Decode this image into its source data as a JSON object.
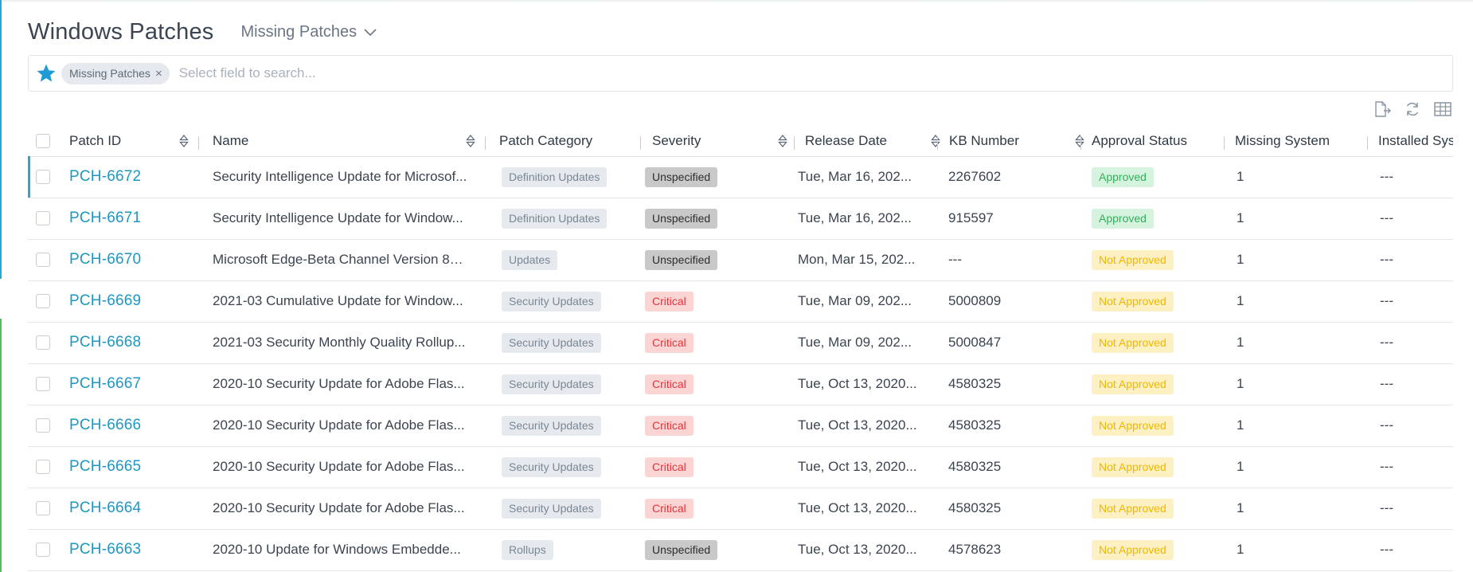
{
  "header": {
    "title": "Windows Patches",
    "view_label": "Missing Patches"
  },
  "search": {
    "chip_label": "Missing Patches",
    "chip_close": "×",
    "placeholder": "Select field to search..."
  },
  "toolbar": {
    "icons": [
      "export-icon",
      "refresh-icon",
      "table-columns-icon"
    ]
  },
  "colors": {
    "accent": "#1d97c4",
    "star": "#1e9ad6",
    "critical_text": "#e0353b",
    "approved_text": "#32b05a",
    "not_approved_text": "#f2b600"
  },
  "table": {
    "columns": [
      "Patch ID",
      "Name",
      "Patch Category",
      "Severity",
      "Release Date",
      "KB Number",
      "Approval Status",
      "Missing System",
      "Installed Sys"
    ],
    "rows": [
      {
        "id": "PCH-6672",
        "name": "Security Intelligence Update for Microsof...",
        "category": "Definition Updates",
        "severity": "Unspecified",
        "release_date": "Tue, Mar 16, 202...",
        "kb": "2267602",
        "approval": "Approved",
        "missing": "1",
        "installed": "---"
      },
      {
        "id": "PCH-6671",
        "name": "Security Intelligence Update for Window...",
        "category": "Definition Updates",
        "severity": "Unspecified",
        "release_date": "Tue, Mar 16, 202...",
        "kb": "915597",
        "approval": "Approved",
        "missing": "1",
        "installed": "---"
      },
      {
        "id": "PCH-6670",
        "name": "Microsoft Edge-Beta Channel Version 89...",
        "category": "Updates",
        "severity": "Unspecified",
        "release_date": "Mon, Mar 15, 202...",
        "kb": "---",
        "approval": "Not Approved",
        "missing": "1",
        "installed": "---"
      },
      {
        "id": "PCH-6669",
        "name": "2021-03 Cumulative Update for Window...",
        "category": "Security Updates",
        "severity": "Critical",
        "release_date": "Tue, Mar 09, 202...",
        "kb": "5000809",
        "approval": "Not Approved",
        "missing": "1",
        "installed": "---"
      },
      {
        "id": "PCH-6668",
        "name": "2021-03 Security Monthly Quality Rollup...",
        "category": "Security Updates",
        "severity": "Critical",
        "release_date": "Tue, Mar 09, 202...",
        "kb": "5000847",
        "approval": "Not Approved",
        "missing": "1",
        "installed": "---"
      },
      {
        "id": "PCH-6667",
        "name": "2020-10 Security Update for Adobe Flas...",
        "category": "Security Updates",
        "severity": "Critical",
        "release_date": "Tue, Oct 13, 2020...",
        "kb": "4580325",
        "approval": "Not Approved",
        "missing": "1",
        "installed": "---"
      },
      {
        "id": "PCH-6666",
        "name": "2020-10 Security Update for Adobe Flas...",
        "category": "Security Updates",
        "severity": "Critical",
        "release_date": "Tue, Oct 13, 2020...",
        "kb": "4580325",
        "approval": "Not Approved",
        "missing": "1",
        "installed": "---"
      },
      {
        "id": "PCH-6665",
        "name": "2020-10 Security Update for Adobe Flas...",
        "category": "Security Updates",
        "severity": "Critical",
        "release_date": "Tue, Oct 13, 2020...",
        "kb": "4580325",
        "approval": "Not Approved",
        "missing": "1",
        "installed": "---"
      },
      {
        "id": "PCH-6664",
        "name": "2020-10 Security Update for Adobe Flas...",
        "category": "Security Updates",
        "severity": "Critical",
        "release_date": "Tue, Oct 13, 2020...",
        "kb": "4580325",
        "approval": "Not Approved",
        "missing": "1",
        "installed": "---"
      },
      {
        "id": "PCH-6663",
        "name": "2020-10 Update for Windows Embedde...",
        "category": "Rollups",
        "severity": "Unspecified",
        "release_date": "Tue, Oct 13, 2020...",
        "kb": "4578623",
        "approval": "Not Approved",
        "missing": "1",
        "installed": "---"
      }
    ]
  }
}
